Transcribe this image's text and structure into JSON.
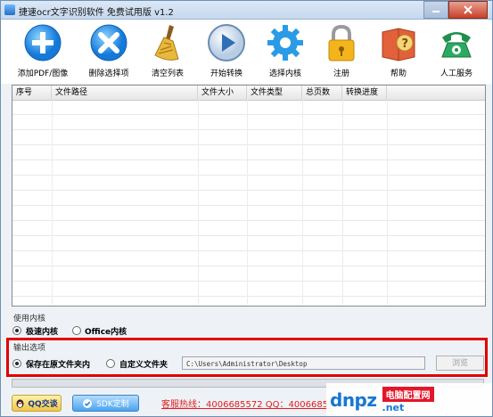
{
  "window": {
    "title": "捷速ocr文字识别软件 免费试用版 v1.2"
  },
  "toolbar": {
    "items": [
      {
        "label": "添加PDF/图像",
        "icon": "plus-circle-icon"
      },
      {
        "label": "删除选择项",
        "icon": "x-circle-icon"
      },
      {
        "label": "清空列表",
        "icon": "broom-icon"
      },
      {
        "label": "开始转换",
        "icon": "play-icon"
      },
      {
        "label": "选择内核",
        "icon": "gear-icon"
      },
      {
        "label": "注册",
        "icon": "lock-icon"
      },
      {
        "label": "帮助",
        "icon": "help-book-icon"
      },
      {
        "label": "人工服务",
        "icon": "phone-icon"
      }
    ]
  },
  "table": {
    "columns": [
      "序号",
      "文件路径",
      "文件大小",
      "文件类型",
      "总页数",
      "转换进度"
    ],
    "rows": []
  },
  "engine": {
    "section_label": "使用内核",
    "options": [
      {
        "label": "极速内核",
        "selected": true
      },
      {
        "label": "Office内核",
        "selected": false
      }
    ]
  },
  "output": {
    "section_label": "输出选项",
    "options": [
      {
        "label": "保存在原文件夹内",
        "selected": true
      },
      {
        "label": "自定义文件夹",
        "selected": false
      }
    ],
    "path_value": "C:\\Users\\Administrator\\Desktop",
    "browse_label": "浏览"
  },
  "footer": {
    "qq_label": "QQ交谈",
    "sdk_label": "SDK定制",
    "hotline": "客服热线：4006685572 QQ：40066855"
  },
  "watermark": {
    "logo": "dnpz",
    "badge": "电脑配置网",
    "domain": ".net"
  },
  "colors": {
    "highlight_box": "#e00000",
    "hotline": "#e01e1e",
    "accent": "#1877d2"
  }
}
